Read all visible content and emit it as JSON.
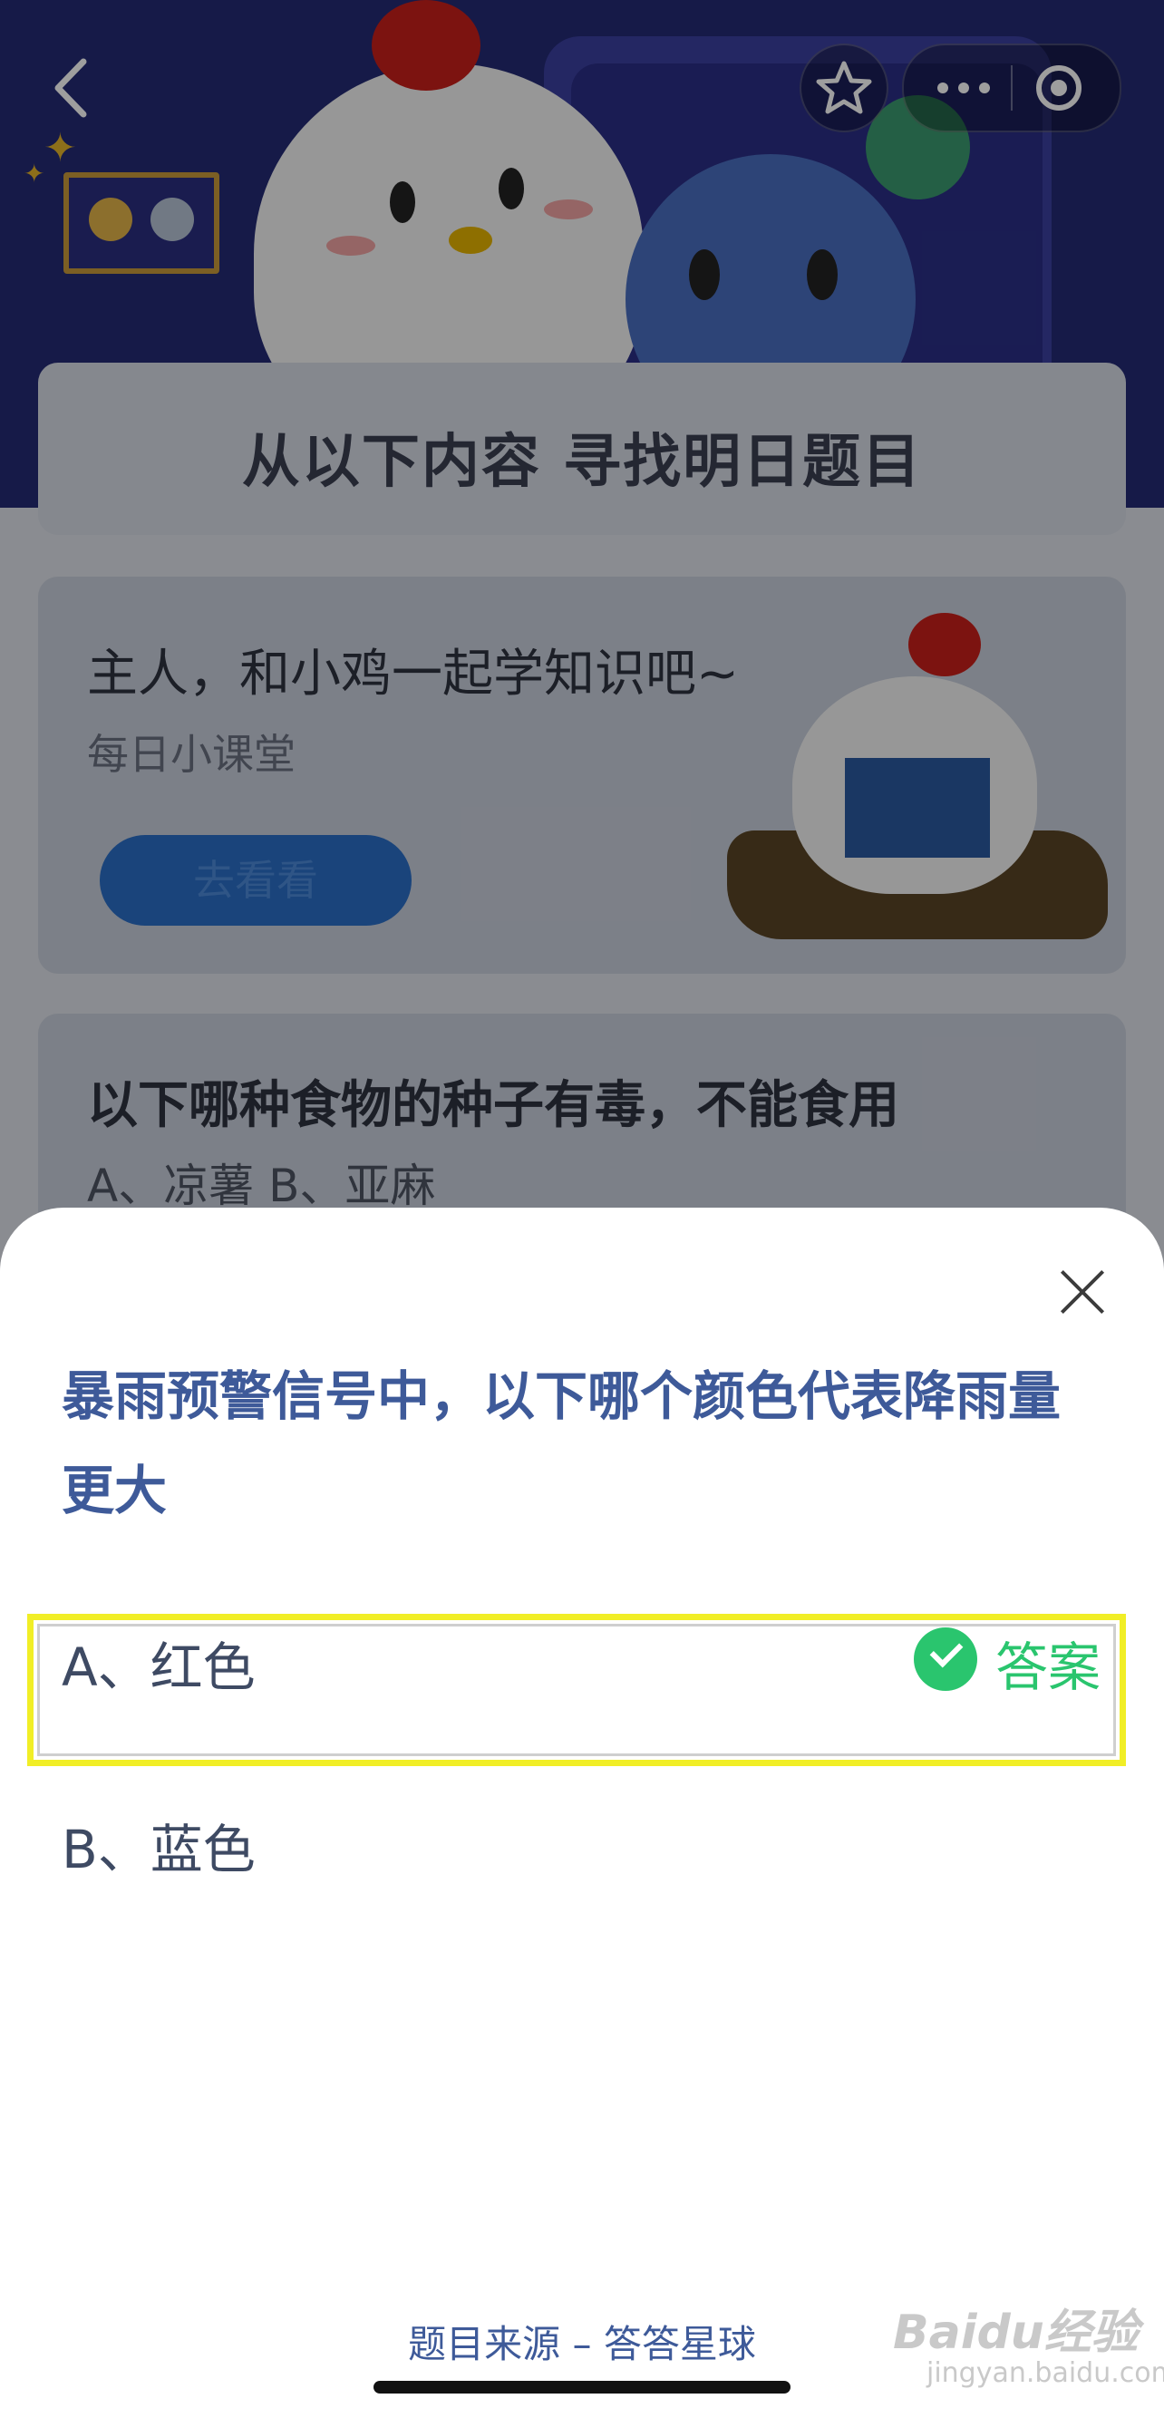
{
  "background": {
    "section_title": "从以下内容 寻找明日题目",
    "lesson_card": {
      "title": "主人，和小鸡一起学知识吧~",
      "subtitle": "每日小课堂",
      "button": "去看看"
    },
    "question_card": {
      "title": "以下哪种食物的种子有毒，不能食用",
      "options": "A、凉薯    B、亚麻"
    }
  },
  "sheet": {
    "question": "暴雨预警信号中，以下哪个颜色代表降雨量更大",
    "options": [
      {
        "label": "A、红色",
        "is_answer": true
      },
      {
        "label": "B、蓝色",
        "is_answer": false
      }
    ],
    "answer_tag": "答案",
    "source": "题目来源 – 答答星球"
  },
  "watermark": {
    "brand": "Baidu经验",
    "url": "jingyan.baidu.com"
  },
  "colors": {
    "question_text": "#3e5a99",
    "answer_green": "#2ac56e",
    "highlight_yellow": "#f1ee26"
  }
}
